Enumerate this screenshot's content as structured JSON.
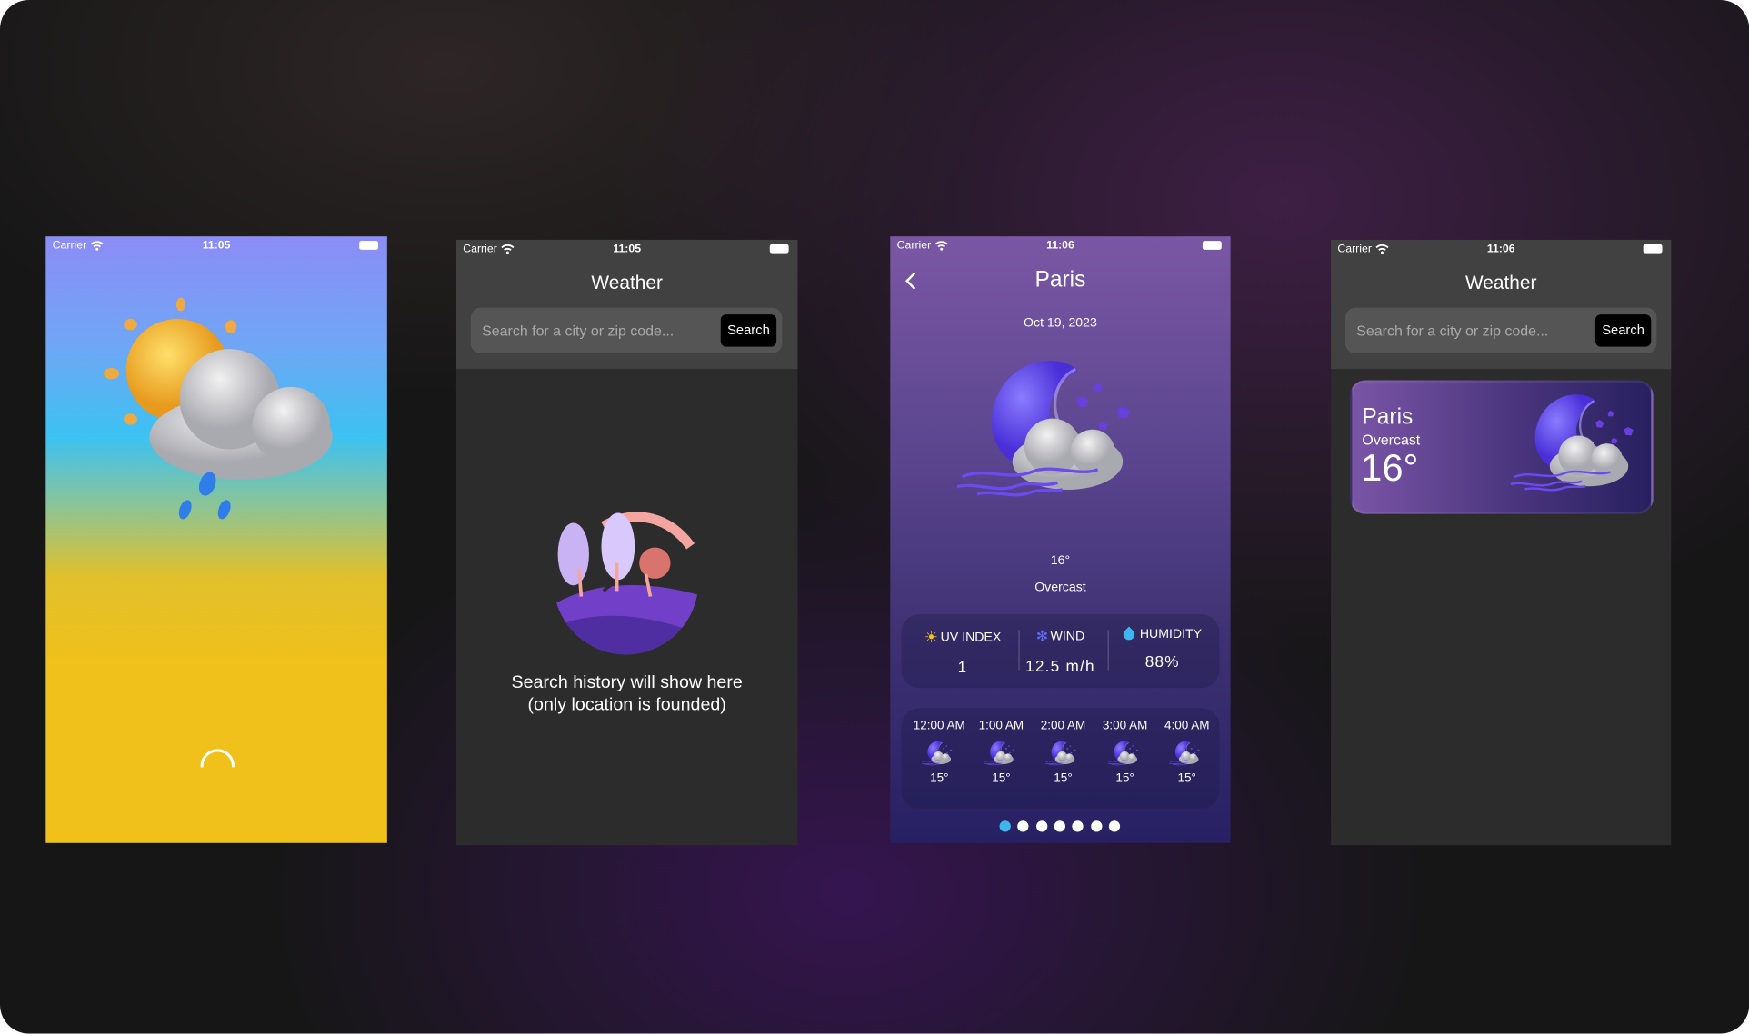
{
  "status_bar": {
    "carrier": "Carrier"
  },
  "screens": [
    {
      "time": "11:05",
      "icon": "sun-cloud-rain-icon",
      "loading": "spinner-icon"
    },
    {
      "time": "11:05",
      "title": "Weather",
      "search": {
        "placeholder": "Search for a city or zip code...",
        "button": "Search"
      },
      "empty": {
        "line1": "Search history will show here",
        "line2": "(only location is founded)"
      }
    },
    {
      "time": "11:06",
      "title": "Paris",
      "date": "Oct 19, 2023",
      "temp": "16°",
      "condition": "Overcast",
      "stats": [
        {
          "label": "UV INDEX",
          "value": "1",
          "icon": "sun-icon"
        },
        {
          "label": "WIND",
          "value": "12.5 m/h",
          "icon": "wind-icon"
        },
        {
          "label": "HUMIDITY",
          "value": "88%",
          "icon": "drop-icon"
        }
      ],
      "hourly": [
        {
          "time": "12:00 AM",
          "temp": "15°"
        },
        {
          "time": "1:00 AM",
          "temp": "15°"
        },
        {
          "time": "2:00 AM",
          "temp": "15°"
        },
        {
          "time": "3:00 AM",
          "temp": "15°"
        },
        {
          "time": "4:00 AM",
          "temp": "15°"
        }
      ],
      "page_dots": {
        "count": 7,
        "active": 0,
        "active_color": "#3db6f0"
      }
    },
    {
      "time": "11:06",
      "title": "Weather",
      "search": {
        "placeholder": "Search for a city or zip code...",
        "button": "Search"
      },
      "history": [
        {
          "city": "Paris",
          "condition": "Overcast",
          "temp": "16°"
        }
      ]
    }
  ]
}
